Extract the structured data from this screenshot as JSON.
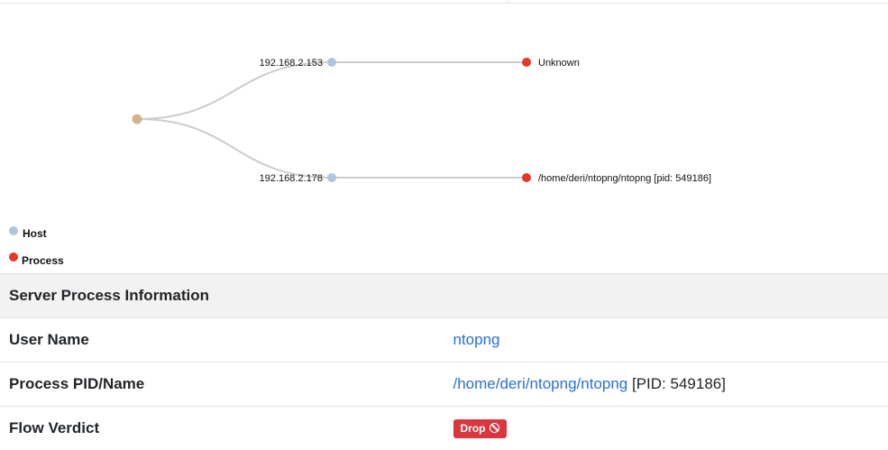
{
  "tree": {
    "hosts": [
      {
        "label": "192.168.2.153",
        "process": "Unknown"
      },
      {
        "label": "192.168.2.178",
        "process": "/home/deri/ntopng/ntopng [pid: 549186]"
      }
    ],
    "colors": {
      "root": "#d4b48a",
      "host": "#b0c4de",
      "process": "#e8362a",
      "link": "#cccccc"
    }
  },
  "legend": {
    "host_label": "Host",
    "process_label": "Process"
  },
  "info_table": {
    "section_title": "Server Process Information",
    "user_name_label": "User Name",
    "user_name_value": "ntopng",
    "pid_label": "Process PID/Name",
    "pid_path": "/home/deri/ntopng/ntopng",
    "pid_suffix": " [PID: 549186]",
    "verdict_label": "Flow Verdict",
    "verdict_value": "Drop",
    "verdict_icon": "ban-icon"
  }
}
